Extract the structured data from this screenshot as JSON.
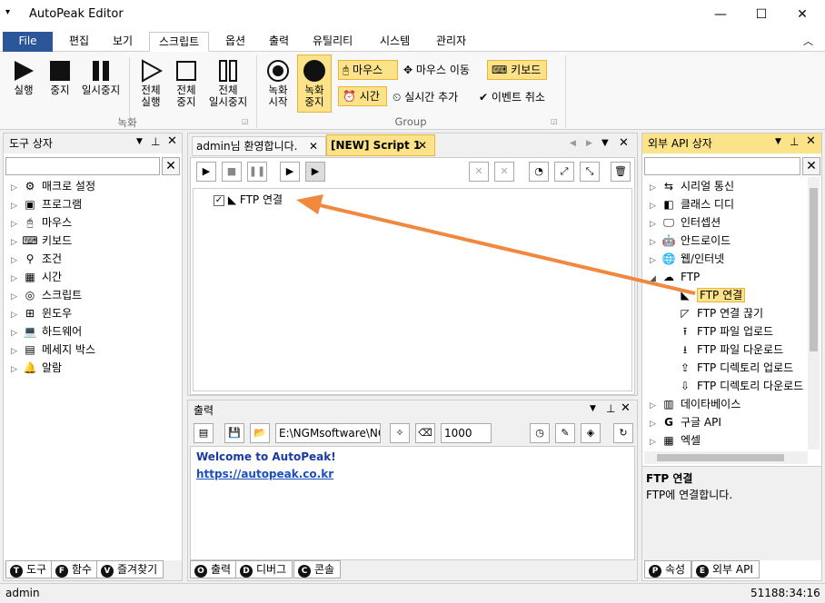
{
  "app": {
    "title": "AutoPeak Editor"
  },
  "window_controls": {
    "minimize": "—",
    "maximize": "☐",
    "close": "✕"
  },
  "menu": {
    "file": "File",
    "items": [
      "편집",
      "보기",
      "스크립트",
      "옵션",
      "출력",
      "유틸리티",
      "시스템",
      "관리자"
    ]
  },
  "ribbon": {
    "record_group": {
      "label": "녹화",
      "run": "실행",
      "stop": "중지",
      "pause": "일시중지",
      "run_all_1": "전체",
      "run_all_2": "실행",
      "stop_all_1": "전체",
      "stop_all_2": "중지",
      "pause_all_1": "전체",
      "pause_all_2": "일시중지"
    },
    "group2": {
      "label": "Group",
      "rec_start_1": "녹화",
      "rec_start_2": "시작",
      "rec_stop_1": "녹화",
      "rec_stop_2": "중지",
      "mouse": "마우스",
      "mouse_move": "마우스 이동",
      "keyboard": "키보드",
      "time": "시간",
      "realtime_add": "실시간 추가",
      "event_cancel": "이벤트 취소"
    }
  },
  "left_panel": {
    "title": "도구 상자",
    "items": [
      "매크로 설정",
      "프로그램",
      "마우스",
      "키보드",
      "조건",
      "시간",
      "스크립트",
      "윈도우",
      "하드웨어",
      "메세지 박스",
      "알람"
    ],
    "tabs": [
      "도구",
      "함수",
      "즐겨찾기"
    ],
    "tab_letters": [
      "T",
      "F",
      "V"
    ]
  },
  "doc_tabs": [
    "admin님 환영합니다.",
    "[NEW] Script 1"
  ],
  "script": {
    "items": [
      {
        "label": "FTP 연결",
        "checked": true
      }
    ]
  },
  "output": {
    "title": "출력",
    "path": "E:\\NGMsoftware\\NG",
    "count": "1000",
    "lines": [
      "Welcome to AutoPeak!",
      "https://autopeak.co.kr"
    ],
    "tabs": [
      "출력",
      "디버그",
      "콘솔"
    ],
    "tab_letters": [
      "O",
      "D",
      "C"
    ]
  },
  "right_panel": {
    "title": "외부 API 상자",
    "items_top": [
      "시리얼 통신",
      "클래스 디디",
      "인터셉션",
      "안드로이드",
      "웹/인터넷"
    ],
    "ftp_group": "FTP",
    "ftp_children": [
      "FTP 연결",
      "FTP 연결 끊기",
      "FTP 파일 업로드",
      "FTP 파일 다운로드",
      "FTP 디렉토리 업로드",
      "FTP 디렉토리 다운로드"
    ],
    "items_bottom": [
      "데이타베이스",
      "구글 API",
      "엑셀"
    ],
    "desc_title": "FTP 연결",
    "desc_text": "FTP에 연결합니다.",
    "tabs": [
      "속성",
      "외부 API"
    ],
    "tab_letters": [
      "P",
      "E"
    ]
  },
  "status": {
    "user": "admin",
    "time": "51188:34:16"
  },
  "colors": {
    "accent": "#2b579a",
    "highlight": "#fce38a",
    "arrow": "#f0883e",
    "link": "#1a4fc0"
  }
}
